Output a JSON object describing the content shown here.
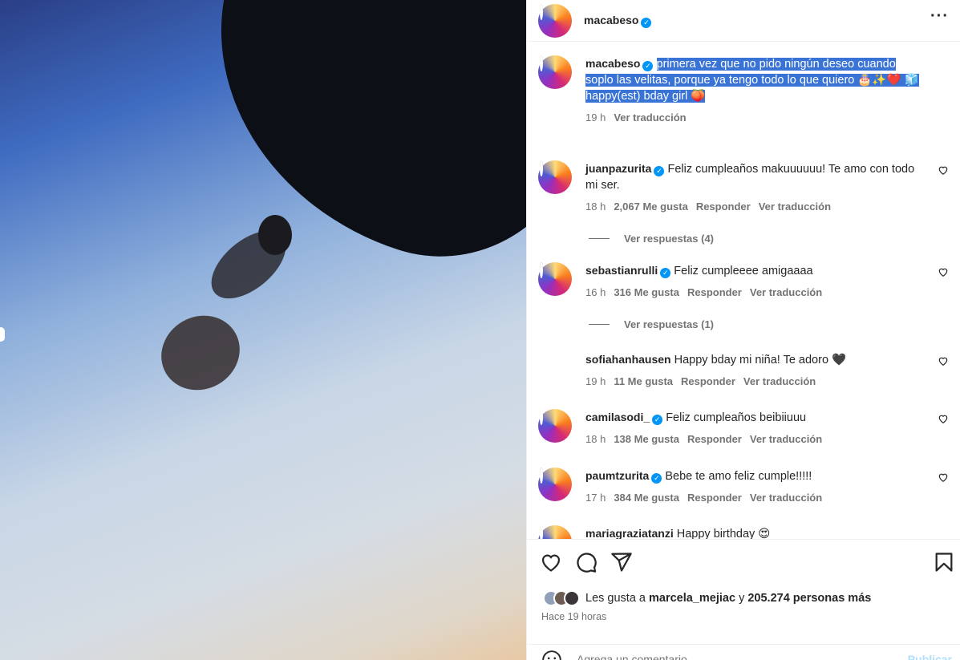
{
  "post": {
    "author": "macabeso",
    "caption_line1": "primera vez que no pido ningún deseo cuando soplo las velitas, porque ya tengo todo lo que quiero 🎂✨❤️ 🧊",
    "caption_line2": "happy(est) bday girl 🍑",
    "caption_time": "19 h",
    "caption_translate": "Ver traducción"
  },
  "comments": [
    {
      "user": "juanpazurita",
      "verified": true,
      "text": "Feliz cumpleaños makuuuuuu! Te amo con todo mi ser.",
      "time": "18 h",
      "likes": "2,067 Me gusta",
      "reply": "Responder",
      "translate": "Ver traducción",
      "replies": "Ver respuestas (4)",
      "avatar_color": "#6b5a4c"
    },
    {
      "user": "sebastianrulli",
      "verified": true,
      "text": "Feliz cumpleeee amigaaaa",
      "time": "16 h",
      "likes": "316 Me gusta",
      "reply": "Responder",
      "translate": "Ver traducción",
      "replies": "Ver respuestas (1)",
      "avatar_color": "#4a3a35"
    },
    {
      "user": "sofiahanhausen",
      "verified": false,
      "text": "Happy bday mi niña! Te adoro 🖤",
      "time": "19 h",
      "likes": "11 Me gusta",
      "reply": "Responder",
      "translate": "Ver traducción",
      "avatar_color": "#8a7a6e"
    },
    {
      "user": "camilasodi_",
      "verified": true,
      "text": "Feliz cumpleaños beibiiuuu",
      "time": "18 h",
      "likes": "138 Me gusta",
      "reply": "Responder",
      "translate": "Ver traducción",
      "avatar_color": "#e6a6b8"
    },
    {
      "user": "paumtzurita",
      "verified": true,
      "text": "Bebe te amo feliz cumple!!!!!",
      "time": "17 h",
      "likes": "384 Me gusta",
      "reply": "Responder",
      "translate": "Ver traducción",
      "avatar_color": "#7a3040"
    },
    {
      "user": "mariagraziatanzi",
      "verified": false,
      "text": "Happy birthday 😍",
      "avatar_color": "#b09a60"
    }
  ],
  "likes": {
    "prefix": "Les gusta a",
    "user": "marcela_mejiac",
    "middle": "y",
    "count": "205.274 personas más"
  },
  "time_ago": "Hace 19 horas",
  "add_comment_placeholder": "Agrega un comentario...",
  "publish_label": "Publicar",
  "icons": {
    "more": "more-horizontal-icon",
    "like": "heart-icon",
    "comment": "comment-icon",
    "share": "send-icon",
    "save": "bookmark-icon",
    "emoji": "smiley-icon"
  },
  "colors": {
    "verified": "#0095f6",
    "selection": "#3a73d6",
    "muted": "#737373"
  }
}
